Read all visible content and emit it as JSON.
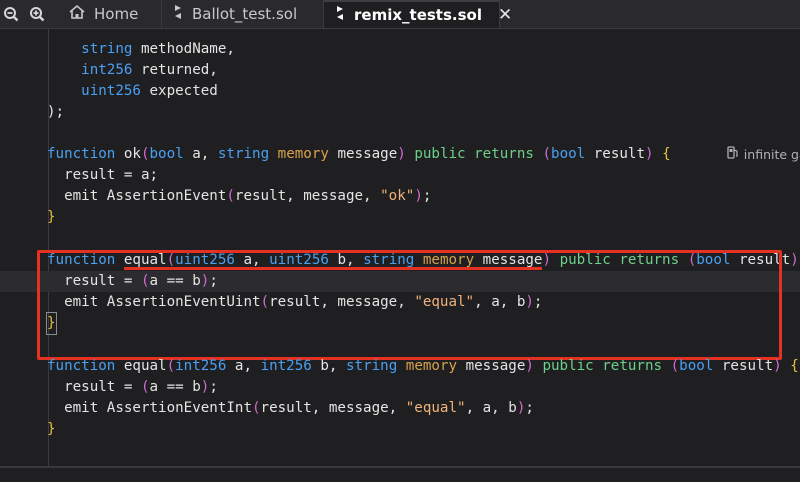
{
  "tabs": [
    {
      "label": "Home",
      "icon": "home-icon",
      "active": false
    },
    {
      "label": "Ballot_test.sol",
      "icon": "solidity-file-icon",
      "active": false
    },
    {
      "label": "remix_tests.sol",
      "icon": "solidity-file-icon",
      "active": true
    }
  ],
  "toolbar": {
    "zoom_out_icon": "zoom-out-icon",
    "zoom_in_icon": "zoom-in-icon",
    "close_symbol": "✕"
  },
  "code": {
    "l1": "    string methodName,",
    "l2": "    int256 returned,",
    "l3": "    uint256 expected",
    "l4": ");",
    "f1_sig_a": "function ok(",
    "f1_sig_b": "bool",
    "f1_sig_c": " a, ",
    "f1_sig_d": "string",
    "f1_sig_e": " ",
    "f1_sig_f": "memory",
    "f1_sig_g": " message) ",
    "f1_sig_h": "public returns",
    "f1_sig_i": " (",
    "f1_sig_j": "bool",
    "f1_sig_k": " result) ",
    "f1_sig_l": "{",
    "f1_body1": "  result = a;",
    "f1_body2a": "  emit AssertionEvent(result, message, ",
    "f1_body2b": "\"ok\"",
    "f1_body2c": ");",
    "f1_close": "}",
    "gas_label": "infinite gas",
    "f2_sig_a": "function ",
    "f2_sig_b": "equal(",
    "f2_sig_c": "uint256",
    "f2_sig_d": " a, ",
    "f2_sig_e": "uint256",
    "f2_sig_f": " b, ",
    "f2_sig_g": "string",
    "f2_sig_h": " ",
    "f2_sig_i": "memory",
    "f2_sig_j": " message) ",
    "f2_sig_k": "public returns",
    "f2_sig_l": " (",
    "f2_sig_m": "bool",
    "f2_sig_n": " result)",
    "f2_body1": "  result = (a == b);",
    "f2_body2a": "  emit AssertionEventUint(result, message, ",
    "f2_body2b": "\"equal\"",
    "f2_body2c": ", a, b);",
    "f2_close": "}",
    "f3_sig_a": "function equal(",
    "f3_sig_b": "int256",
    "f3_sig_c": " a, ",
    "f3_sig_d": "int256",
    "f3_sig_e": " b, ",
    "f3_sig_f": "string",
    "f3_sig_g": " ",
    "f3_sig_h": "memory",
    "f3_sig_i": " message) ",
    "f3_sig_j": "public returns",
    "f3_sig_k": " (",
    "f3_sig_l": "bool",
    "f3_sig_m": " result) ",
    "f3_sig_n": "{",
    "f3_body1": "  result = (a == b);",
    "f3_body2a": "  emit AssertionEventInt(result, message, ",
    "f3_body2b": "\"equal\"",
    "f3_body2c": ", a, b);",
    "f3_close": "}"
  },
  "colors": {
    "highlight_box": "#e43122",
    "keyword": "#4aa0f0",
    "string": "#f0b27a"
  }
}
